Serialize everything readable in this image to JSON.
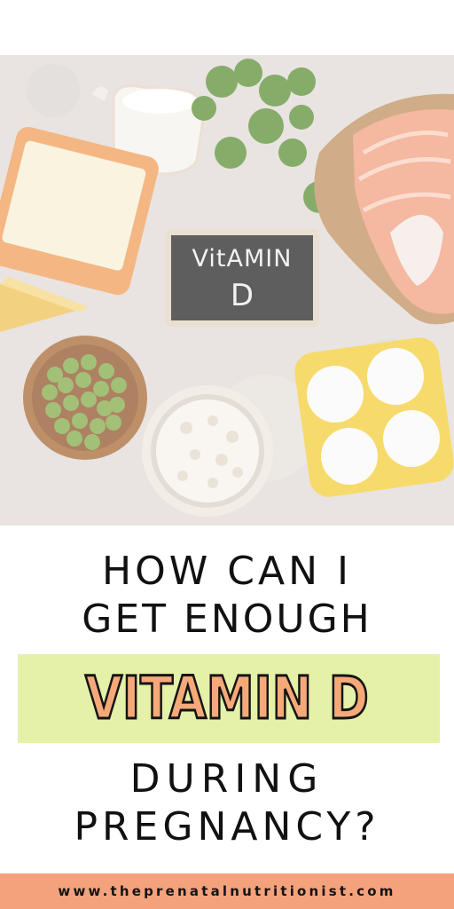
{
  "photo": {
    "alt_subject": "vitamin-d-foods-flatlay",
    "chalkboard": {
      "line1": "VitAMIN",
      "line2": "D"
    }
  },
  "headline": {
    "line1": "HOW CAN I",
    "line2": "GET ENOUGH",
    "highlight": "VITAMIN D",
    "line4": "DURING",
    "line5": "PREGNANCY?"
  },
  "footer": {
    "url": "www.theprenatalnutritionist.com"
  },
  "colors": {
    "highlight_bg": "#e5f0a8",
    "highlight_text": "#f5a978",
    "footer_bg": "#f4a27c",
    "text": "#111111"
  }
}
